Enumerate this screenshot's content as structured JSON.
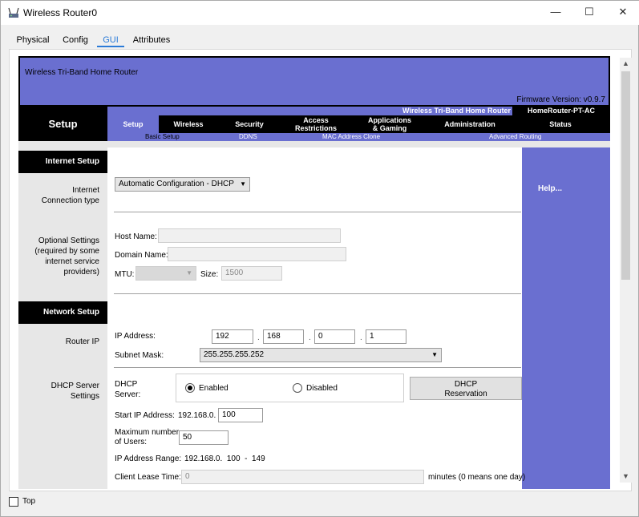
{
  "window": {
    "title": "Wireless Router0",
    "minimize": "—",
    "maximize": "☐",
    "close": "✕"
  },
  "tabs": [
    "Physical",
    "Config",
    "GUI",
    "Attributes"
  ],
  "banner": {
    "product": "Wireless Tri-Band Home Router",
    "firmware": "Firmware Version: v0.9.7"
  },
  "nav": {
    "section_title": "Setup",
    "model_name": "Wireless Tri-Band Home Router",
    "model_id": "HomeRouter-PT-AC",
    "items": [
      "Setup",
      "Wireless",
      "Security",
      "Access\nRestrictions",
      "Applications\n& Gaming",
      "Administration",
      "Status"
    ],
    "sub_items": [
      "Basic Setup",
      "DDNS",
      "MAC Address Clone",
      "Advanced Routing"
    ]
  },
  "help": {
    "label": "Help..."
  },
  "internet_setup": {
    "header": "Internet Setup",
    "connection_type_label": "Internet\nConnection type",
    "connection_type_value": "Automatic Configuration - DHCP",
    "optional_label": "Optional Settings\n(required by some\ninternet service\nproviders)",
    "host_name_label": "Host Name:",
    "host_name_value": "",
    "domain_name_label": "Domain Name:",
    "domain_name_value": "",
    "mtu_label": "MTU:",
    "mtu_value": "",
    "size_label": "Size:",
    "size_value": "1500"
  },
  "network_setup": {
    "header": "Network Setup",
    "router_ip_label": "Router IP",
    "ip_address_label": "IP Address:",
    "ip_octets": [
      "192",
      "168",
      "0",
      "1"
    ],
    "dot": ".",
    "subnet_mask_label": "Subnet Mask:",
    "subnet_mask_value": "255.255.255.252",
    "dhcp_label": "DHCP Server\nSettings",
    "dhcp_server_label": "DHCP\nServer:",
    "enabled_label": "Enabled",
    "disabled_label": "Disabled",
    "dhcp_enabled": true,
    "reservation_button": "DHCP\nReservation",
    "start_ip_label": "Start IP Address:",
    "start_ip_prefix": "192.168.0.",
    "start_ip_value": "100",
    "max_users_label": "Maximum number\nof Users:",
    "max_users_value": "50",
    "ip_range_label": "IP Address Range:",
    "ip_range_value": "192.168.0.  100  -  149",
    "lease_time_label": "Client Lease Time:",
    "lease_time_value": "0",
    "lease_time_suffix": "minutes (0 means one day)"
  },
  "bottom": {
    "top_label": "Top",
    "top_checked": false
  }
}
